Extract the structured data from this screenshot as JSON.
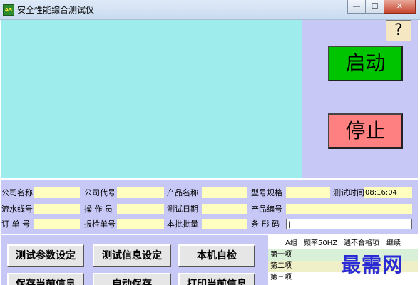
{
  "window": {
    "title": "安全性能综合测试仪",
    "icon_text": "AS",
    "controls": {
      "minimize": "—",
      "maximize": "☐",
      "close": "✕"
    }
  },
  "display": {
    "help_label": "?",
    "start_label": "启动",
    "stop_label": "停止"
  },
  "info": {
    "company_name_label": "公司名称",
    "company_code_label": "公司代号",
    "product_name_label": "产品名称",
    "model_label": "型号规格",
    "test_time_label": "测试时间",
    "test_time_value": "08:16:04",
    "line_no_label": "流水线号",
    "operator_label": "操 作 员",
    "test_date_label": "测试日期",
    "product_no_label": "产品编号",
    "order_no_label": "订 单 号",
    "inspect_no_label": "报检单号",
    "batch_label": "本批批量",
    "barcode_label": "条 形 码",
    "barcode_value": "|"
  },
  "buttons": {
    "test_params": "测试参数设定",
    "test_info": "测试信息设定",
    "self_check": "本机自检",
    "save_current": "保存当前信息",
    "auto_save": "自动保存",
    "print_current": "打印当前信息"
  },
  "results": {
    "group": "A组",
    "frequency": "频率50HZ",
    "on_fail": "遇不合格项",
    "action": "继续",
    "items": [
      "第一项",
      "第二项",
      "第三项"
    ]
  },
  "watermark": "最需网"
}
